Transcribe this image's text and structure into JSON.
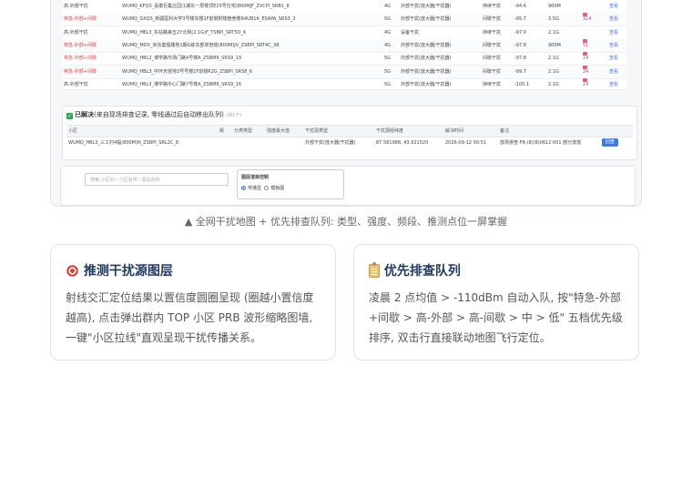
{
  "top_table": {
    "rows": [
      {
        "type": "高-外部干扰",
        "type_red": false,
        "cell": "WUMQ_KFQS_喜康巨集庄园(1期东一层楼顶E25号住宅)800MJF_ZVCPI_SRB1_8",
        "band": "4G",
        "kind": "外部干扰(放大器/干扰器)",
        "status": "持续干扰",
        "val": "-94.6",
        "num": "900M",
        "tag": "",
        "link": "查看"
      },
      {
        "type": "特急-外部+间歇",
        "type_red": true,
        "cell": "WUMQ_GXQS_新疆医科大学3号楼东楼1F前侧附楼宿舍楼R4UB1A_ESAPA_SRS3_2",
        "band": "5G",
        "kind": "外部干扰(放大器/干扰器)",
        "status": "间歇干扰",
        "val": "-95.7",
        "num": "3.5G",
        "tag": "314",
        "link": "查看"
      },
      {
        "type": "高-外部干扰",
        "type_red": false,
        "cell": "WUMQ_HBL3_东站路第五2Y北侧(2.1G)F_TSBPI_SRT5O_6",
        "band": "4G",
        "kind": "设备干扰",
        "status": "持续干扰",
        "val": "-97.0",
        "num": "2.1G",
        "tag": "",
        "link": "查看"
      },
      {
        "type": "特急-外部+间歇",
        "type_red": true,
        "cell": "WUMQ_MDX_米东套屋路地1期G栋东部单管塔(800M)JV_ZSBPI_SRT4C_38",
        "band": "4G",
        "kind": "外部干扰(放大器/干扰器)",
        "status": "间歇干扰",
        "val": "-97.8",
        "num": "900M",
        "tag": "51",
        "link": "查看"
      },
      {
        "type": "特急-外部+间歇",
        "type_red": true,
        "cell": "WUMQ_HBL2_博学路市场门路4号楼A_ZSBM6_SRS9_19",
        "band": "5G",
        "kind": "外部干扰(放大器/干扰器)",
        "status": "间歇干扰",
        "val": "-97.8",
        "num": "2.1G",
        "tag": "24",
        "link": "查看"
      },
      {
        "type": "特急-外部+间歇",
        "type_red": true,
        "cell": "WUMQ_HBL3_中环天悦地3号号楼1F前侧R2G_ZSBPI_SRS8_6",
        "band": "5G",
        "kind": "外部干扰(放大器/干扰器)",
        "status": "间歇干扰",
        "val": "-99.7",
        "num": "2.1G",
        "tag": "24",
        "link": "查看"
      },
      {
        "type": "高-外部干扰",
        "type_red": false,
        "cell": "WUMQ_HBL3_博学路中心门路7号楼A_ZSBM6_SRS9_16",
        "band": "5G",
        "kind": "外部干扰(放大器/干扰器)",
        "status": "持续干扰",
        "val": "-100.1",
        "num": "2.1G",
        "tag": "24",
        "link": "查看"
      }
    ]
  },
  "resolved": {
    "title_bold": "已解决",
    "title_rest": "(来自现场排查记录, 零线通过后自动移出队列)",
    "count": "(共1个)",
    "headers": [
      "小区",
      "频",
      "分类类型",
      "强度最大值",
      "干扰源类型",
      "干扰源经纬度",
      "解决时间",
      "备注"
    ],
    "row": {
      "cell": "WUMQ_HBL3_三工村4幅(800M)N_ZSBPI_SRL2C_8",
      "kind": "外部干扰(放大器/干扰器)",
      "coord": "87.581988, 43.921520",
      "time": "2026-09-12 00:51",
      "note": "放场排查·FR·(8)(8)0612·001·部分落落",
      "button": "回查"
    }
  },
  "filter": {
    "placeholder": "搜索·小区ID / 小区名称 / 基站名称",
    "ctrl_title": "图层渲染控制",
    "opt1": "传播型",
    "opt2": "模板图"
  },
  "caption": "▲ 全网干扰地图 + 优先排查队列: 类型、强度、频段、推测点位一屏掌握",
  "cards": [
    {
      "title": "推测干扰源图层",
      "icon": "target-icon",
      "body": "射线交汇定位结果以置信度圆圈呈现 (圈越小置信度越高), 点击弹出群内 TOP 小区 PRB 波形缩略图墙, 一键\"小区拉线\"直观呈现干扰传播关系。"
    },
    {
      "title": "优先排查队列",
      "icon": "clipboard-icon",
      "body": "凌晨 2 点均值 > -110dBm 自动入队, 按\"特急-外部+间歇 > 高-外部 > 高-间歇 > 中 > 低\" 五档优先级排序, 双击行直接联动地图飞行定位。"
    }
  ]
}
